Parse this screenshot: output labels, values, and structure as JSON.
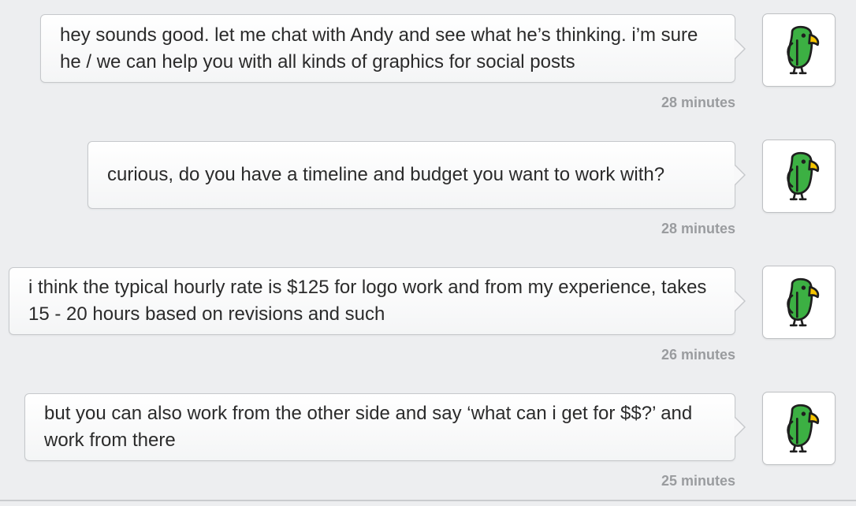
{
  "messages": [
    {
      "text": "hey sounds good. let me chat with Andy and see what he’s thinking. i’m sure he / we can help you with all kinds of graphics for social posts",
      "time": "28 minutes"
    },
    {
      "text": "curious, do you have a timeline and budget you want to work with?",
      "time": "28 minutes"
    },
    {
      "text": "i think the typical hourly rate is $125 for logo work and from my experience, takes 15 - 20 hours based on revisions and such",
      "time": "26 minutes"
    },
    {
      "text": "but you can also work from the other side and say ‘what can i get for $$?’ and work from there",
      "time": "25 minutes"
    }
  ],
  "avatar_icon": "parrot-icon",
  "colors": {
    "parrot_green": "#3cb043",
    "beak_yellow": "#f5c400",
    "outline": "#1e1e1e",
    "timestamp": "#9a9c9f"
  }
}
